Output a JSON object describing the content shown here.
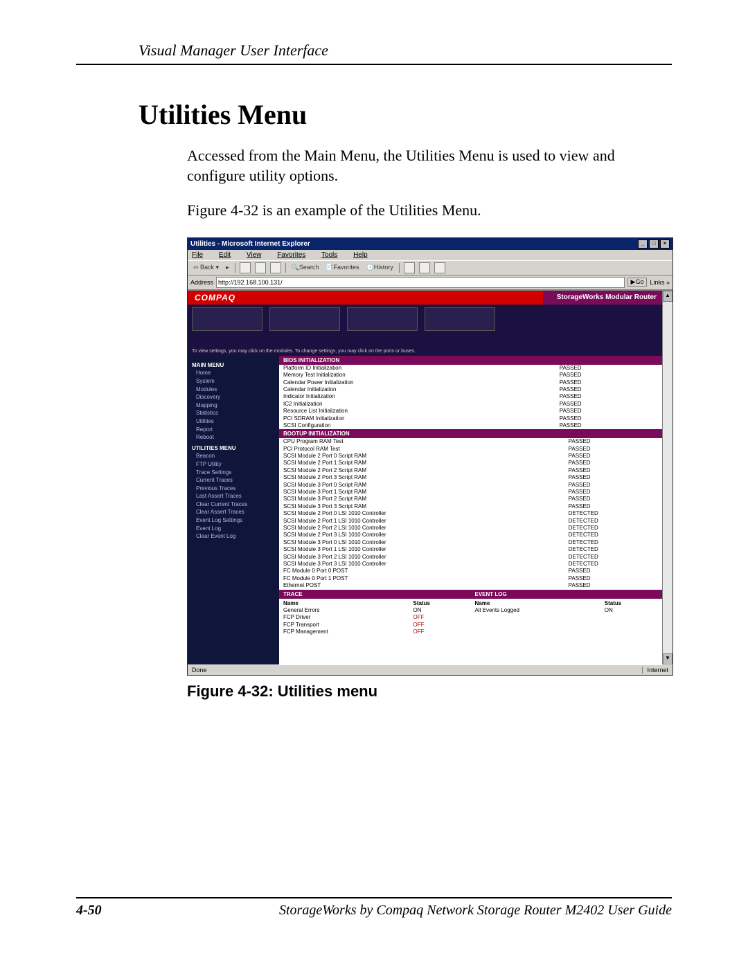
{
  "doc": {
    "running_header": "Visual Manager User Interface",
    "title": "Utilities Menu",
    "intro": "Accessed from the Main Menu, the Utilities Menu is used to view and configure utility options.",
    "fig_ref": "Figure 4-32 is an example of the Utilities Menu.",
    "caption": "Figure 4-32:  Utilities menu",
    "page_num": "4-50",
    "footer": "StorageWorks by Compaq Network Storage Router M2402 User Guide"
  },
  "ie": {
    "title": "Utilities - Microsoft Internet Explorer",
    "menu": [
      "File",
      "Edit",
      "View",
      "Favorites",
      "Tools",
      "Help"
    ],
    "toolbar": {
      "back": "⇦ Back ▾",
      "search": "🔍Search",
      "favorites": "📑Favorites",
      "history": "🕓History"
    },
    "addr_label": "Address",
    "url": "http://192.168.100.131/",
    "go": "▶Go",
    "links": "Links »",
    "status": "Done",
    "zone": "Internet"
  },
  "app": {
    "brand": "COMPAQ",
    "product": "StorageWorks Modular Router",
    "hero_hint": "To view settings, you may click on the modules. To change settings, you may click on the ports or buses."
  },
  "sidebar": {
    "main_hd": "MAIN MENU",
    "main": [
      "Home",
      "System",
      "Modules",
      "Discovery",
      "Mapping",
      "Statistics",
      "Utilities",
      "Report",
      "Reboot"
    ],
    "util_hd": "UTILITIES MENU",
    "util": [
      "Beacon",
      "FTP Utility",
      "Trace Settings",
      "Current Traces",
      "Previous Traces",
      "Last Assert Traces",
      "Clear Current Traces",
      "Clear Assert Traces",
      "Event Log Settings",
      "Event Log",
      "Clear Event Log"
    ]
  },
  "sections": {
    "bios": "BIOS INITIALIZATION",
    "bootup": "BOOTUP INITIALIZATION",
    "trace": "TRACE",
    "eventlog": "EVENT LOG"
  },
  "bios": [
    {
      "n": "Platform ID Initialization",
      "s": "PASSED"
    },
    {
      "n": "Memory Test Initialization",
      "s": "PASSED"
    },
    {
      "n": "Calendar Power Initialization",
      "s": "PASSED"
    },
    {
      "n": "Calendar Initialization",
      "s": "PASSED"
    },
    {
      "n": "Indicator Initialization",
      "s": "PASSED"
    },
    {
      "n": "IC2 Initialization",
      "s": "PASSED"
    },
    {
      "n": "Resource List Initialization",
      "s": "PASSED"
    },
    {
      "n": "PCI SDRAM Initialization",
      "s": "PASSED"
    },
    {
      "n": "SCSI Configuration",
      "s": "PASSED"
    }
  ],
  "boot": [
    {
      "n": "CPU Program RAM Test",
      "s": "PASSED"
    },
    {
      "n": "PCI Protocol RAM Test",
      "s": "PASSED"
    },
    {
      "n": "SCSI Module 2 Port 0 Script RAM",
      "s": "PASSED"
    },
    {
      "n": "SCSI Module 2 Port 1 Script RAM",
      "s": "PASSED"
    },
    {
      "n": "SCSI Module 2 Port 2 Script RAM",
      "s": "PASSED"
    },
    {
      "n": "SCSI Module 2 Port 3 Script RAM",
      "s": "PASSED"
    },
    {
      "n": "SCSI Module 3 Port 0 Script RAM",
      "s": "PASSED"
    },
    {
      "n": "SCSI Module 3 Port 1 Script RAM",
      "s": "PASSED"
    },
    {
      "n": "SCSI Module 3 Port 2 Script RAM",
      "s": "PASSED"
    },
    {
      "n": "SCSI Module 3 Port 3 Script RAM",
      "s": "PASSED"
    },
    {
      "n": "SCSI Module 2 Port 0 LSI 1010 Controller",
      "s": "DETECTED"
    },
    {
      "n": "SCSI Module 2 Port 1 LSI 1010 Controller",
      "s": "DETECTED"
    },
    {
      "n": "SCSI Module 2 Port 2 LSI 1010 Controller",
      "s": "DETECTED"
    },
    {
      "n": "SCSI Module 2 Port 3 LSI 1010 Controller",
      "s": "DETECTED"
    },
    {
      "n": "SCSI Module 3 Port 0 LSI 1010 Controller",
      "s": "DETECTED"
    },
    {
      "n": "SCSI Module 3 Port 1 LSI 1010 Controller",
      "s": "DETECTED"
    },
    {
      "n": "SCSI Module 3 Port 2 LSI 1010 Controller",
      "s": "DETECTED"
    },
    {
      "n": "SCSI Module 3 Port 3 LSI 1010 Controller",
      "s": "DETECTED"
    },
    {
      "n": "FC Module 0 Port 0 POST",
      "s": "PASSED"
    },
    {
      "n": "FC Module 0 Port 1 POST",
      "s": "PASSED"
    },
    {
      "n": "Ethernet POST",
      "s": "PASSED"
    }
  ],
  "trace": {
    "head": [
      "Name",
      "Status"
    ],
    "rows": [
      {
        "n": "General Errors",
        "s": "ON"
      },
      {
        "n": "FCP Driver",
        "s": "OFF"
      },
      {
        "n": "FCP Transport",
        "s": "OFF"
      },
      {
        "n": "FCP Management",
        "s": "OFF"
      }
    ]
  },
  "eventlog": {
    "head": [
      "Name",
      "Status"
    ],
    "rows": [
      {
        "n": "All Events Logged",
        "s": "ON"
      }
    ]
  }
}
